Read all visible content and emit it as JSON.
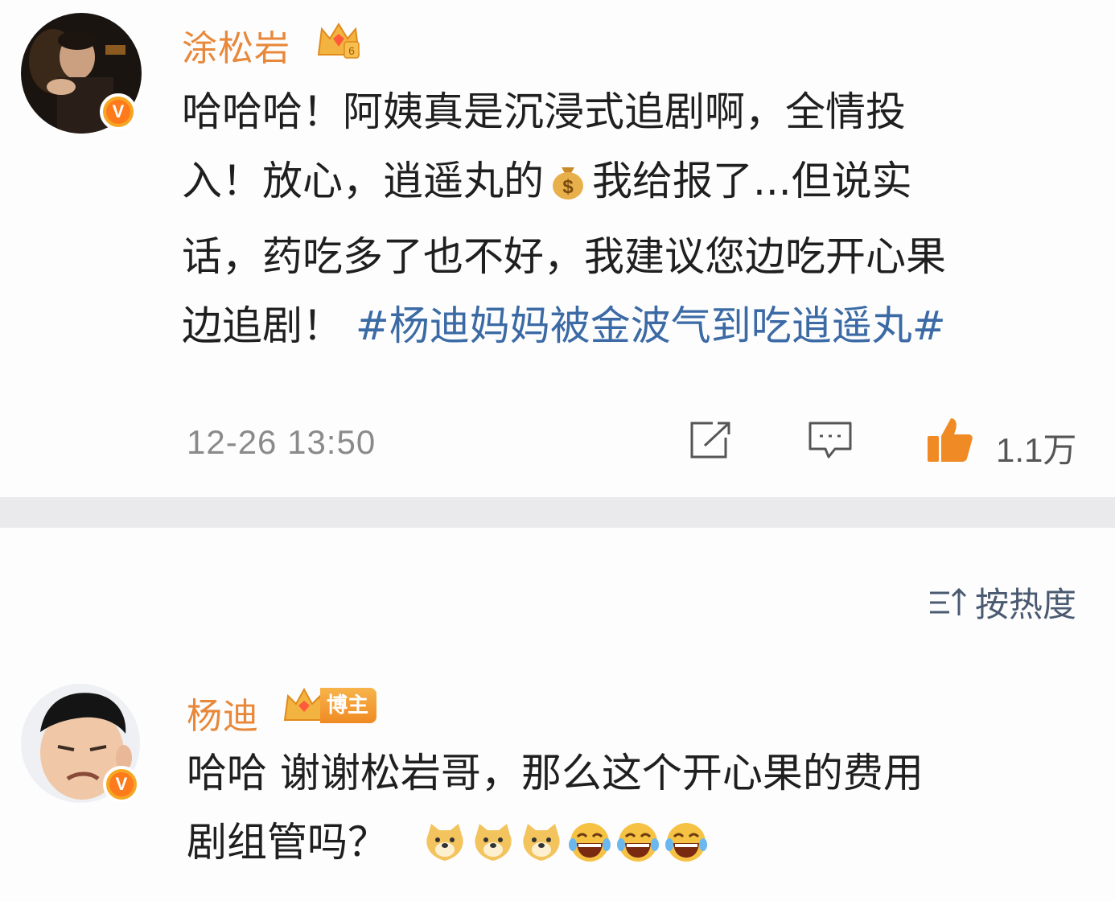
{
  "post": {
    "username": "涂松岩",
    "text_lines": [
      "哈哈哈！阿姨真是沉浸式追剧啊，全情投",
      "入！放心，逍遥丸的",
      "我给报了...但说实",
      "话，药吃多了也不好，我建议您边吃开心果",
      "边追剧！"
    ],
    "hashtag": "#杨迪妈妈被金波气到吃逍遥丸#",
    "timestamp": "12-26 13:50",
    "like_count": "1.1万",
    "icons": [
      "share-icon",
      "comment-icon",
      "like-icon",
      "money-bag-icon",
      "verified-icon",
      "crown-level-icon"
    ]
  },
  "sort": {
    "label": "按热度"
  },
  "comment": {
    "username": "杨迪",
    "badge_label": "博主",
    "text_line1": "哈哈 谢谢松岩哥，那么这个开心果的费用",
    "text_line2": "剧组管吗？",
    "emojis": [
      "doge",
      "doge",
      "doge",
      "laugh-cry",
      "laugh-cry",
      "laugh-cry"
    ]
  },
  "colors": {
    "username": "#e8883a",
    "hashtag": "#3b6aa5",
    "meta": "#8a8a8a",
    "like": "#f08a24",
    "divider": "#eaeaec"
  }
}
